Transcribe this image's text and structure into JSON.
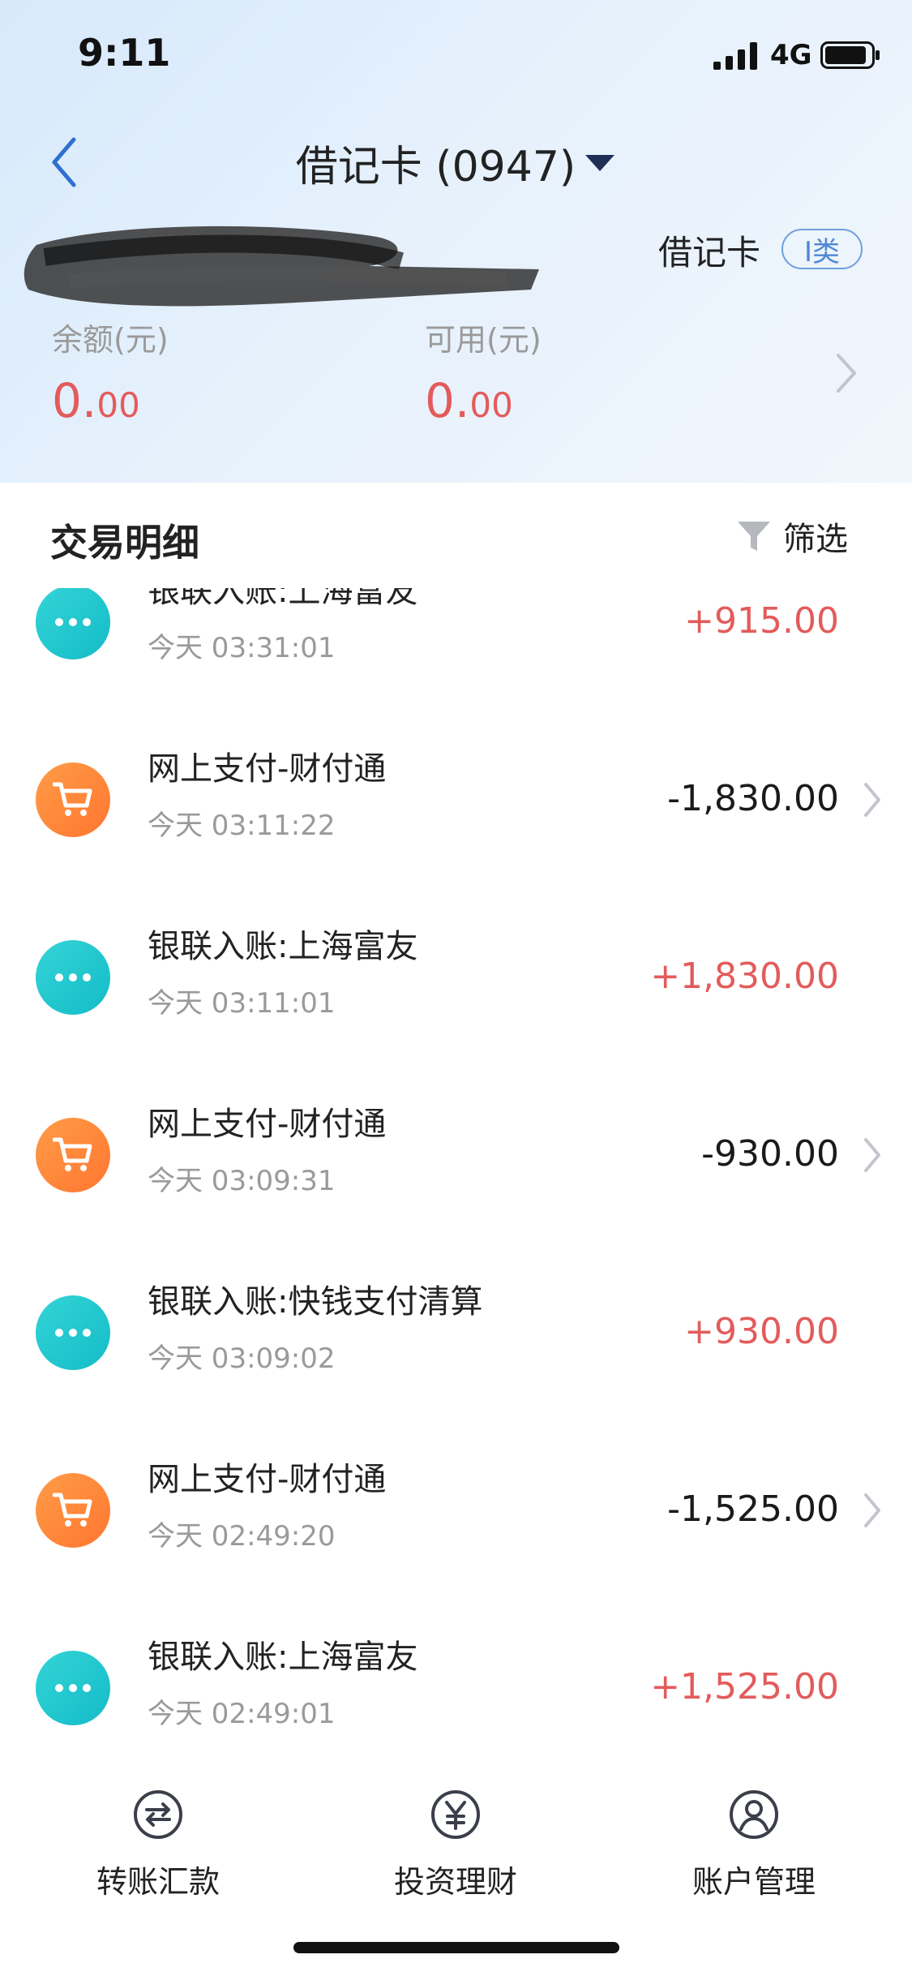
{
  "status_bar": {
    "time": "9:11",
    "network": "4G"
  },
  "nav": {
    "title": "借记卡 (0947)"
  },
  "card": {
    "type": "借记卡",
    "class_badge": "I类"
  },
  "balance": {
    "balance_label": "余额(元)",
    "balance_int": "0.",
    "balance_dec": "00",
    "available_label": "可用(元)",
    "available_int": "0.",
    "available_dec": "00"
  },
  "section": {
    "title": "交易明细",
    "filter_label": "筛选"
  },
  "transactions": [
    {
      "title": "银联入账:上海富友",
      "time": "今天  03:31:01",
      "amount": "+915.00",
      "kind": "transfer"
    },
    {
      "title": "网上支付-财付通",
      "time": "今天  03:11:22",
      "amount": "-1,830.00",
      "kind": "pay"
    },
    {
      "title": "银联入账:上海富友",
      "time": "今天  03:11:01",
      "amount": "+1,830.00",
      "kind": "transfer"
    },
    {
      "title": "网上支付-财付通",
      "time": "今天  03:09:31",
      "amount": "-930.00",
      "kind": "pay"
    },
    {
      "title": "银联入账:快钱支付清算",
      "time": "今天  03:09:02",
      "amount": "+930.00",
      "kind": "transfer"
    },
    {
      "title": "网上支付-财付通",
      "time": "今天  02:49:20",
      "amount": "-1,525.00",
      "kind": "pay"
    },
    {
      "title": "银联入账:上海富友",
      "time": "今天  02:49:01",
      "amount": "+1,525.00",
      "kind": "transfer"
    }
  ],
  "tabs": [
    {
      "label": "转账汇款",
      "icon": "transfer-icon"
    },
    {
      "label": "投资理财",
      "icon": "yen-icon"
    },
    {
      "label": "账户管理",
      "icon": "user-icon"
    }
  ],
  "colors": {
    "positive_amount": "#e35b5b",
    "negative_amount": "#1a1a1a",
    "transfer_icon_bg": "#1fc6cf",
    "pay_icon_bg": "#ff8a3d",
    "accent": "#2f6fd1"
  }
}
